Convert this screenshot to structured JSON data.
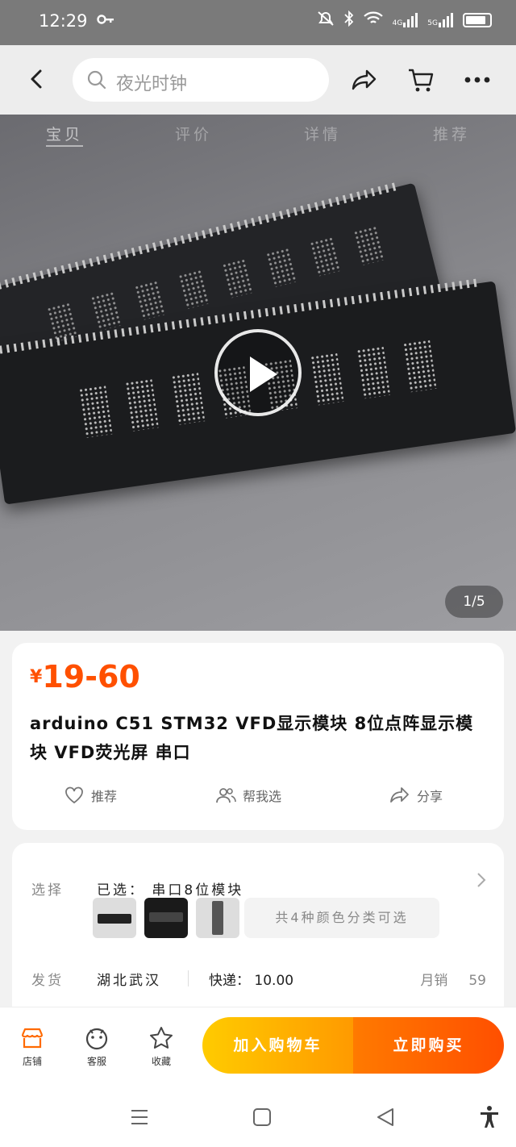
{
  "status_bar": {
    "time": "12:29",
    "network_1": "4G",
    "network_2": "5G",
    "battery_level": 0.85
  },
  "header": {
    "search_placeholder": "夜光时钟"
  },
  "media": {
    "tabs": [
      {
        "label": "宝贝",
        "active": true
      },
      {
        "label": "评价",
        "active": false
      },
      {
        "label": "详情",
        "active": false
      },
      {
        "label": "推荐",
        "active": false
      }
    ],
    "pager": "1/5"
  },
  "product": {
    "currency": "¥",
    "price": "19-60",
    "title": "arduino C51 STM32 VFD显示模块 8位点阵显示模块 VFD荧光屏 串口",
    "actions": {
      "recommend": "推荐",
      "help_choose": "帮我选",
      "share": "分享"
    }
  },
  "details": {
    "select_label": "选择",
    "selected": "已选： 串口8位模块",
    "colors_note": "共4种颜色分类可选",
    "ship_label": "发货",
    "ship_from": "湖北武汉",
    "express": "快递： 10.00",
    "monthly_label": "月销",
    "monthly_sales": "59"
  },
  "bottom_bar": {
    "store": "店铺",
    "service": "客服",
    "favorite": "收藏",
    "add_to_cart": "加入购物车",
    "buy_now": "立即购买"
  },
  "colors": {
    "accent": "#ff5000",
    "cart_gradient_start": "#ffcb00",
    "buy_gradient_end": "#ff4f00"
  }
}
